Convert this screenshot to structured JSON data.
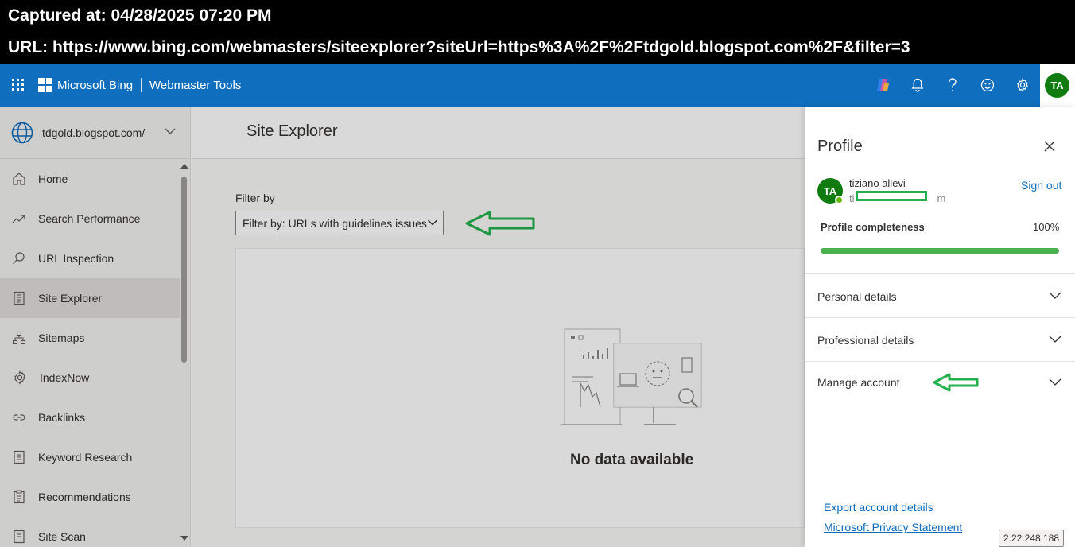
{
  "capture": {
    "line1": "Captured at: 04/28/2025 07:20 PM",
    "line2": "URL: https://www.bing.com/webmasters/siteexplorer?siteUrl=https%3A%2F%2Ftdgold.blogspot.com%2F&filter=3"
  },
  "topbar": {
    "brand": "Microsoft Bing",
    "product": "Webmaster Tools",
    "avatar_initials": "TA",
    "icons": [
      "app-launcher-icon",
      "copilot-icon",
      "bell-icon",
      "help-icon",
      "feedback-smiley-icon",
      "gear-icon"
    ]
  },
  "sidebar": {
    "site": "tdgold.blogspot.com/",
    "items": [
      {
        "label": "Home",
        "icon": "home-icon"
      },
      {
        "label": "Search Performance",
        "icon": "trend-icon"
      },
      {
        "label": "URL Inspection",
        "icon": "search-icon"
      },
      {
        "label": "Site Explorer",
        "icon": "document-list-icon",
        "active": true
      },
      {
        "label": "Sitemaps",
        "icon": "sitemap-icon"
      },
      {
        "label": "IndexNow",
        "icon": "gear-icon"
      },
      {
        "label": "Backlinks",
        "icon": "link-icon"
      },
      {
        "label": "Keyword Research",
        "icon": "document-icon"
      },
      {
        "label": "Recommendations",
        "icon": "clipboard-icon"
      },
      {
        "label": "Site Scan",
        "icon": "scan-icon"
      }
    ]
  },
  "main": {
    "title": "Site Explorer",
    "filter_label": "Filter by",
    "filter_value": "Filter by: URLs with guidelines issues",
    "empty_message": "No data available"
  },
  "profile": {
    "title": "Profile",
    "initials": "TA",
    "name": "tiziano allevi",
    "email_start": "ti",
    "email_end": "m",
    "sign_out": "Sign out",
    "completeness_label": "Profile completeness",
    "completeness_value": "100%",
    "completeness_fraction": 1.0,
    "sections": [
      "Personal details",
      "Professional details",
      "Manage account"
    ],
    "links": [
      "Export account details",
      "Microsoft Privacy Statement"
    ]
  },
  "ip": "2.22.248.188",
  "colors": {
    "topbar": "#106ebe",
    "avatar": "#107c10",
    "progress": "#4caf50",
    "annotation": "#22b14c",
    "link": "#0f6cbd"
  }
}
